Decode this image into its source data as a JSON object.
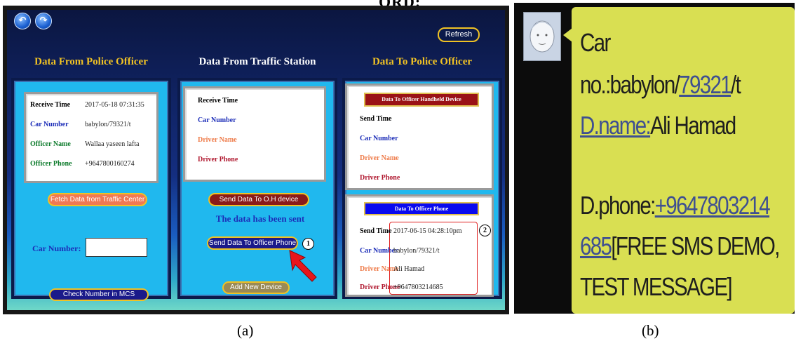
{
  "top_fragment": "ORD:",
  "captions": {
    "a": "(a)",
    "b": "(b)"
  },
  "nav": {
    "back_icon": "undo-arrow-icon",
    "forward_icon": "redo-arrow-icon",
    "refresh_label": "Refresh"
  },
  "columns": {
    "police": {
      "title": "Data From Police Officer",
      "fields": [
        {
          "label": "Receive Time",
          "value": "2017-05-18 07:31:35",
          "color": "#000000"
        },
        {
          "label": "Car Number",
          "value": "babylon/79321/t",
          "color": "#1c2db8"
        },
        {
          "label": "Officer Name",
          "value": "Wallaa yaseen lafta",
          "color": "#0b7a2a"
        },
        {
          "label": "Officer Phone",
          "value": "+9647800160274",
          "color": "#0b7a2a"
        }
      ],
      "fetch_button": "Fetch Data from Traffic Center",
      "car_number_label": "Car Number:",
      "car_number_value": "",
      "check_button": "Check Number in MCS"
    },
    "station": {
      "title": "Data From Traffic Station",
      "fields": [
        {
          "label": "Receive Time",
          "color": "#000000"
        },
        {
          "label": "Car Number",
          "color": "#1c2db8"
        },
        {
          "label": "Driver Name",
          "color": "#ee7a48"
        },
        {
          "label": "Driver Phone",
          "color": "#b0182f"
        }
      ],
      "send_oh_button": "Send Data To O.H device",
      "sent_message": "The data has been sent",
      "send_phone_button": "Send Data To Officer Phone",
      "marker_1": "1",
      "add_device_button": "Add New Device"
    },
    "to_officer": {
      "title": "Data To Police Officer",
      "handheld": {
        "header": "Data To Officer Handheld Device",
        "fields": [
          {
            "label": "Send Time",
            "color": "#000000"
          },
          {
            "label": "Car Number",
            "color": "#1c2db8"
          },
          {
            "label": "Driver Name",
            "color": "#ee7a48"
          },
          {
            "label": "Driver Phone",
            "color": "#b0182f"
          }
        ]
      },
      "phone": {
        "header": "Data To Officer Phone",
        "marker_2": "2",
        "fields": [
          {
            "label": "Send Time",
            "value": "2017-06-15 04:28:10pm",
            "color": "#000000"
          },
          {
            "label": "Car Number",
            "value": "babylon/79321/t",
            "color": "#1c2db8"
          },
          {
            "label": "Driver Name",
            "value": "Ali Hamad",
            "color": "#ee7a48"
          },
          {
            "label": "Driver Phone",
            "value": "+9647803214685",
            "color": "#b0182f"
          }
        ]
      }
    }
  },
  "sms": {
    "avatar_icon": "contact-avatar-icon",
    "line1": "Car",
    "line2_prefix": "no.:babylon/",
    "line2_link": "79321",
    "line2_suffix": "/t",
    "line3_link": "D.name:",
    "line3_text": "Ali Hamad",
    "line4_text": "D.phone:",
    "line4_link": "+9647803214",
    "line5_link": "685",
    "line5_text": "[FREE SMS DEMO,",
    "line6": "TEST MESSAGE]"
  },
  "colors": {
    "accent_gold": "#f0c224",
    "panel_blue": "#20b8ee",
    "sms_bubble": "#d9df52",
    "sms_link": "#3e4f91"
  }
}
